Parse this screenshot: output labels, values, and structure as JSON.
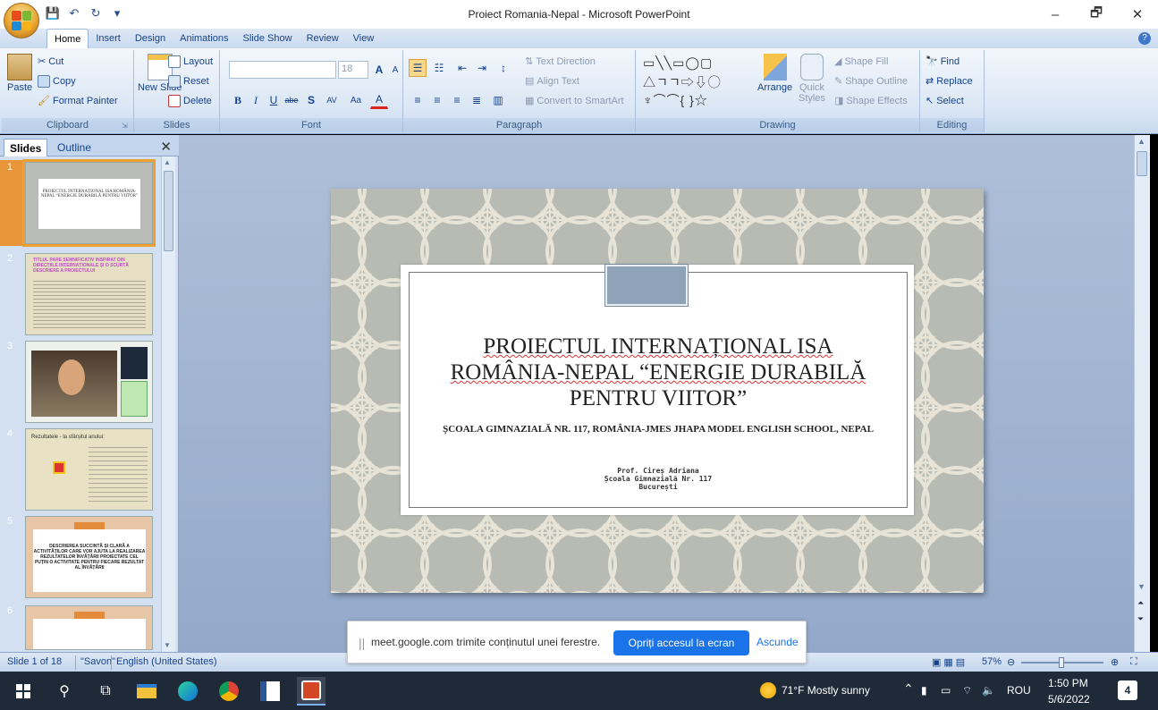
{
  "window": {
    "title": "Proiect Romania-Nepal - Microsoft PowerPoint",
    "minimize": "–",
    "maximize": "🗗",
    "close": "✕"
  },
  "qat": {
    "save": "💾",
    "undo": "↶",
    "redo": "↻",
    "more": "▾"
  },
  "tabs": [
    "Home",
    "Insert",
    "Design",
    "Animations",
    "Slide Show",
    "Review",
    "View"
  ],
  "help": "?",
  "ribbon": {
    "clipboard": {
      "label": "Clipboard",
      "paste": "Paste",
      "cut": "Cut",
      "copy": "Copy",
      "format_painter": "Format Painter"
    },
    "slides": {
      "label": "Slides",
      "new_slide": "New Slide",
      "layout": "Layout",
      "reset": "Reset",
      "delete": "Delete"
    },
    "font": {
      "label": "Font",
      "size": "18",
      "grow": "A",
      "shrink": "A",
      "clear": "A",
      "bold": "B",
      "italic": "I",
      "underline": "U",
      "strike": "abe",
      "shadow": "S",
      "spacing": "AV",
      "case": "Aa",
      "color": "A"
    },
    "paragraph": {
      "label": "Paragraph",
      "text_direction": "Text Direction",
      "align_text": "Align Text",
      "convert_smartart": "Convert to SmartArt"
    },
    "drawing": {
      "label": "Drawing",
      "arrange": "Arrange",
      "quick_styles": "Quick Styles",
      "shape_fill": "Shape Fill",
      "shape_outline": "Shape Outline",
      "shape_effects": "Shape Effects"
    },
    "editing": {
      "label": "Editing",
      "find": "Find",
      "replace": "Replace",
      "select": "Select"
    }
  },
  "pane": {
    "tab_slides": "Slides",
    "tab_outline": "Outline",
    "close": "✕",
    "thumbs": [
      {
        "num": "1",
        "text": "PROIECTUL INTERNAȚIONAL ISA ROMÂNIA-NEPAL “ENERGIE DURABILĂ PENTRU VIITOR”"
      },
      {
        "num": "2",
        "text": "TITLUL PARE SEMNIFICATIV INSPIRAT DIN DIRECȚIILE INTERNAȚIONALE ȘI O SCURTĂ DESCRIERE A PROIECTULUI"
      },
      {
        "num": "3",
        "text": ""
      },
      {
        "num": "4",
        "text": "Rezultatele - la sfârșitul anului:"
      },
      {
        "num": "5",
        "text": "DESCRIEREA SUCCINTĂ ȘI CLARĂ A ACTIVITĂȚILOR CARE VOR AJUTA LA REALIZAREA REZULTATELOR ÎNVĂȚĂRII PROIECTATE CEL PUȚIN O ACTIVITATE PENTRU FIECARE REZULTAT AL ÎNVĂȚĂRII"
      },
      {
        "num": "6",
        "text": ""
      }
    ]
  },
  "slide": {
    "title_lines": [
      "PROIECTUL INTERNAȚIONAL ISA",
      "ROMÂNIA-NEPAL “ENERGIE DURABILĂ",
      "PENTRU VIITOR”"
    ],
    "subtitle": "ȘCOALA GIMNAZIALĂ NR. 117, ROMÂNIA-JMES JHAPA MODEL ENGLISH SCHOOL, NEPAL",
    "author": [
      "Prof. Cireș Adriana",
      "Școala Gimnazială Nr. 117",
      "București"
    ]
  },
  "share_bar": {
    "handle": "||",
    "message": "meet.google.com trimite conținutul unei ferestre.",
    "stop": "Opriți accesul la ecran",
    "hide": "Ascunde"
  },
  "status": {
    "slide_info": "Slide 1 of 18",
    "theme": "\"Savon\"",
    "language": "English (United States)",
    "zoom": "57%"
  },
  "taskbar": {
    "weather": "71°F  Mostly sunny",
    "lang": "ROU",
    "time": "1:50 PM",
    "date": "5/6/2022",
    "notif": "4"
  }
}
